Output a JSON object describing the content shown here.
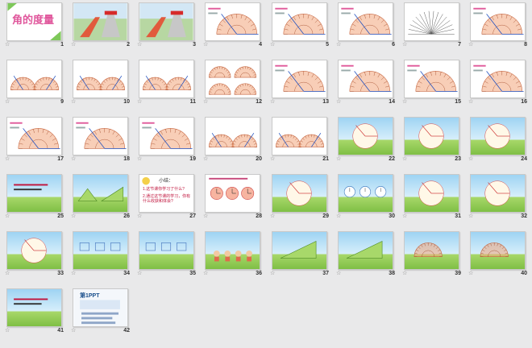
{
  "slides": [
    {
      "n": "1",
      "kind": "title"
    },
    {
      "n": "2",
      "kind": "slide-photo"
    },
    {
      "n": "3",
      "kind": "slide-photo"
    },
    {
      "n": "4",
      "kind": "protractor"
    },
    {
      "n": "5",
      "kind": "protractor"
    },
    {
      "n": "6",
      "kind": "protractor"
    },
    {
      "n": "7",
      "kind": "rays"
    },
    {
      "n": "8",
      "kind": "protractor"
    },
    {
      "n": "9",
      "kind": "protractor-pair"
    },
    {
      "n": "10",
      "kind": "protractor-pair"
    },
    {
      "n": "11",
      "kind": "protractor-pair"
    },
    {
      "n": "12",
      "kind": "protractor-grid"
    },
    {
      "n": "13",
      "kind": "protractor"
    },
    {
      "n": "14",
      "kind": "protractor"
    },
    {
      "n": "15",
      "kind": "protractor"
    },
    {
      "n": "16",
      "kind": "protractor"
    },
    {
      "n": "17",
      "kind": "protractor"
    },
    {
      "n": "18",
      "kind": "protractor"
    },
    {
      "n": "19",
      "kind": "protractor"
    },
    {
      "n": "20",
      "kind": "protractor-pair"
    },
    {
      "n": "21",
      "kind": "protractor-pair"
    },
    {
      "n": "22",
      "kind": "scene"
    },
    {
      "n": "23",
      "kind": "scene"
    },
    {
      "n": "24",
      "kind": "scene"
    },
    {
      "n": "25",
      "kind": "scene-text"
    },
    {
      "n": "26",
      "kind": "triangles"
    },
    {
      "n": "27",
      "kind": "summary"
    },
    {
      "n": "28",
      "kind": "clocks"
    },
    {
      "n": "29",
      "kind": "scene-circle"
    },
    {
      "n": "30",
      "kind": "clocks-scene"
    },
    {
      "n": "31",
      "kind": "scene-circle"
    },
    {
      "n": "32",
      "kind": "scene-circle"
    },
    {
      "n": "33",
      "kind": "scene-circle"
    },
    {
      "n": "34",
      "kind": "scene-angles"
    },
    {
      "n": "35",
      "kind": "scene-boxes"
    },
    {
      "n": "36",
      "kind": "scene-kids"
    },
    {
      "n": "37",
      "kind": "scene-triangle"
    },
    {
      "n": "38",
      "kind": "scene-triangle"
    },
    {
      "n": "39",
      "kind": "scene-protractor"
    },
    {
      "n": "40",
      "kind": "scene-protractor"
    },
    {
      "n": "41",
      "kind": "scene-text"
    },
    {
      "n": "42",
      "kind": "ppt-ad"
    }
  ],
  "title_slide": {
    "text": "角的度量"
  },
  "summary_slide": {
    "heading": "小结：",
    "q1": "1.这节课你学习了什么?",
    "q2": "2.通过这节课的学习，你有什么收获和体会?"
  },
  "ad_slide": {
    "logo": "第1PPT"
  },
  "star_glyph": "☆",
  "colors": {
    "pink": "#e0579c",
    "protractor": "#f2a57c",
    "sky": "#9ed3f3",
    "grass": "#7fbf45"
  }
}
